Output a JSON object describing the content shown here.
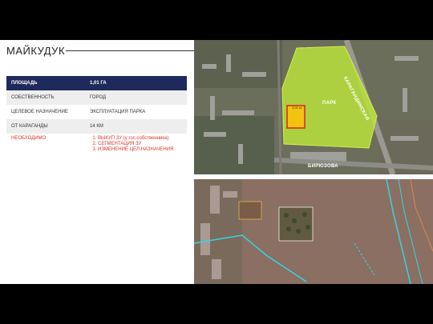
{
  "title": "МАЙКУДУК",
  "table": {
    "header": {
      "label": "ПЛОЩАДЬ",
      "value": "1,01 ГА"
    },
    "rows": [
      {
        "label": "СОБСТВЕННОСТЬ",
        "value": "ГОРОД"
      },
      {
        "label": "ЦЕЛЕВОЕ НАЗНАЧЕНИЕ",
        "value": "ЭКСПЛУАТАЦИЯ ПАРКА"
      },
      {
        "label": "ОТ КАРАГАНДЫ",
        "value": "14 КМ"
      }
    ],
    "required": {
      "label": "НЕОБХОДИМО",
      "items": [
        "ВЫКУП ЗУ (у гос.собственника)",
        "СЕГМЕНТАЦИЯ ЗУ",
        "ИЗМЕНЕНИЕ ЦЕЛ.НАЗНАЧЕНИЯ"
      ]
    }
  },
  "map_top": {
    "park_label": "ПАРК",
    "street_label_1": "КАРАГАНДИНСКАЯ",
    "street_label_2": "БИРЮЗОВА",
    "plot_label": "1,01 га"
  },
  "colors": {
    "header_bg": "#1f2a5c",
    "highlight_text": "#d9342b",
    "park_fill": "#b7e23a",
    "plot_fill": "#f2c40f",
    "boundary": "#35d4e6"
  }
}
